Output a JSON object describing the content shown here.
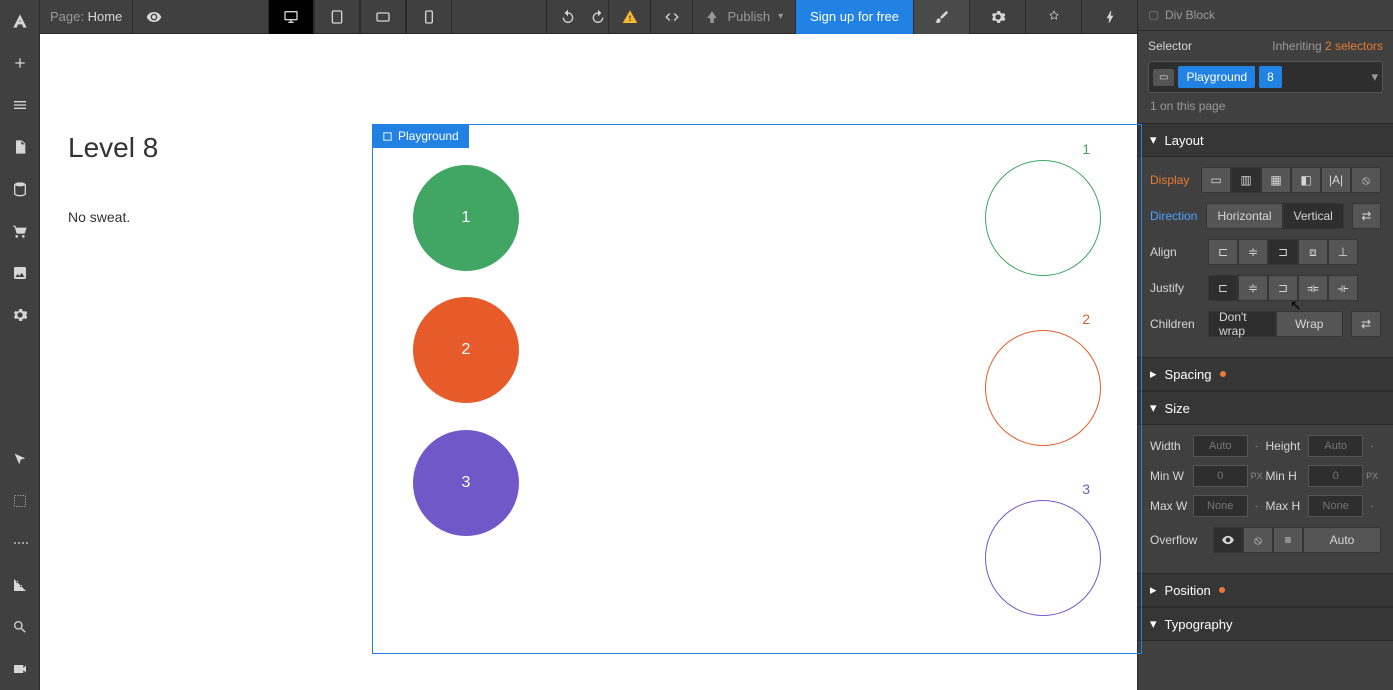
{
  "header": {
    "page_label": "Page:",
    "page_name": "Home",
    "publish_label": "Publish",
    "signup_label": "Sign up for free"
  },
  "canvas": {
    "level_title": "Level 8",
    "level_subtitle": "No sweat.",
    "badge_label": "Playground",
    "circles": [
      "1",
      "2",
      "3"
    ],
    "outlines": [
      "1",
      "2",
      "3"
    ]
  },
  "panel": {
    "breadcrumb": "Div Block",
    "selector_label": "Selector",
    "inheriting_label": "Inheriting",
    "inheriting_link": "2 selectors",
    "selector_tag": "Playground",
    "selector_num": "8",
    "count_text": "1 on this page",
    "sections": {
      "layout": "Layout",
      "spacing": "Spacing",
      "size": "Size",
      "position": "Position",
      "typography": "Typography"
    },
    "layout": {
      "display_label": "Display",
      "direction_label": "Direction",
      "direction_h": "Horizontal",
      "direction_v": "Vertical",
      "align_label": "Align",
      "justify_label": "Justify",
      "children_label": "Children",
      "dont_wrap": "Don't wrap",
      "wrap": "Wrap"
    },
    "size": {
      "width_label": "Width",
      "height_label": "Height",
      "minw_label": "Min W",
      "minh_label": "Min H",
      "maxw_label": "Max W",
      "maxh_label": "Max H",
      "auto": "Auto",
      "none": "None",
      "zero": "0",
      "px": "PX",
      "dash": "-",
      "overflow_label": "Overflow",
      "overflow_auto": "Auto"
    }
  }
}
